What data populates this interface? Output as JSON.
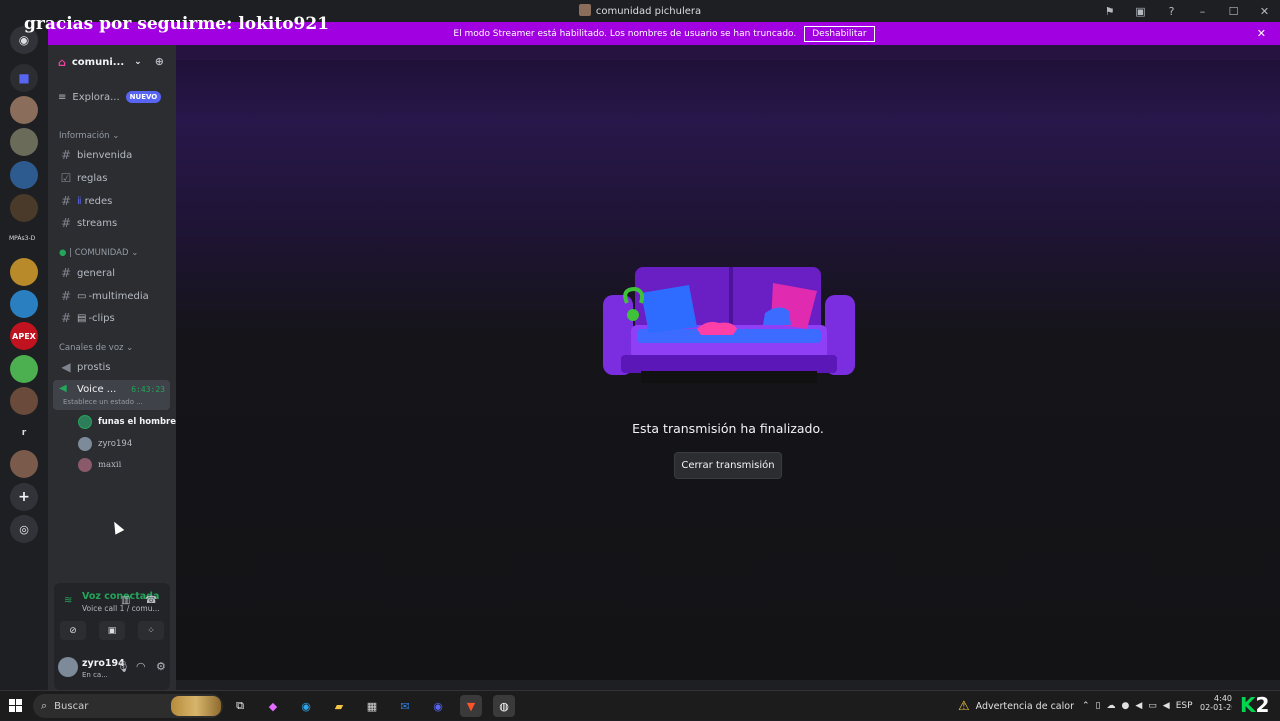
{
  "overlay": {
    "text": "gracias por seguirme: lokito921"
  },
  "window": {
    "title": "comunidad pichulera"
  },
  "streamer_bar": {
    "message": "El modo Streamer está habilitado. Los nombres de usuario se han truncado.",
    "button": "Deshabilitar"
  },
  "server_list": {
    "home_icon": "discord-icon",
    "items": [
      {
        "name": "server-folder",
        "color": "#5865f2"
      },
      {
        "name": "comunidad-pichulera",
        "color": "#8a6d5a"
      },
      {
        "name": "server-2",
        "color": "#6b6b5a"
      },
      {
        "name": "server-3",
        "color": "#2d5a8f"
      },
      {
        "name": "server-4",
        "color": "#4a3a2a"
      },
      {
        "name": "server-5",
        "color": "#b88a2a"
      },
      {
        "name": "server-6",
        "color": "#2a7fc0"
      },
      {
        "name": "apex",
        "color": "#c0121f"
      },
      {
        "name": "server-8",
        "color": "#4caf50"
      },
      {
        "name": "server-9",
        "color": "#6a4a3a"
      },
      {
        "name": "server-10",
        "color": "#1e1f22"
      },
      {
        "name": "server-11",
        "color": "#7a5a4a"
      }
    ],
    "text_label": "MPÀs3-D",
    "apex_label": "APEX",
    "r_label": "r"
  },
  "guild": {
    "name": "comuni...",
    "explore": "Explora...",
    "new_badge": "NUEVO"
  },
  "categories": {
    "info": "Información",
    "community": "| COMUNIDAD",
    "voice": "Canales de voz"
  },
  "channels": {
    "bienvenida": "bienvenida",
    "reglas": "reglas",
    "redes": "redes",
    "streams": "streams",
    "general": "general",
    "multimedia": "-multimedia",
    "clips": "-clips",
    "prostis": "prostis"
  },
  "voice_channel": {
    "name": "Voice ...",
    "timer": "6:43:23",
    "status": "Establece un estado ..."
  },
  "voice_users": [
    "funas el hombre",
    "zyro194",
    "maxii"
  ],
  "voice_panel": {
    "title": "Voz conectada",
    "subtitle": "Voice call 1 / comu..."
  },
  "user": {
    "name": "zyro194",
    "status": "En ca..."
  },
  "stream": {
    "ended_text": "Esta transmisión ha finalizado.",
    "close_button": "Cerrar transmisión"
  },
  "taskbar": {
    "search_placeholder": "Buscar",
    "heat_warning": "Advertencia de calor",
    "lang": "ESP",
    "time": "4:40",
    "date": "02-01-202"
  }
}
